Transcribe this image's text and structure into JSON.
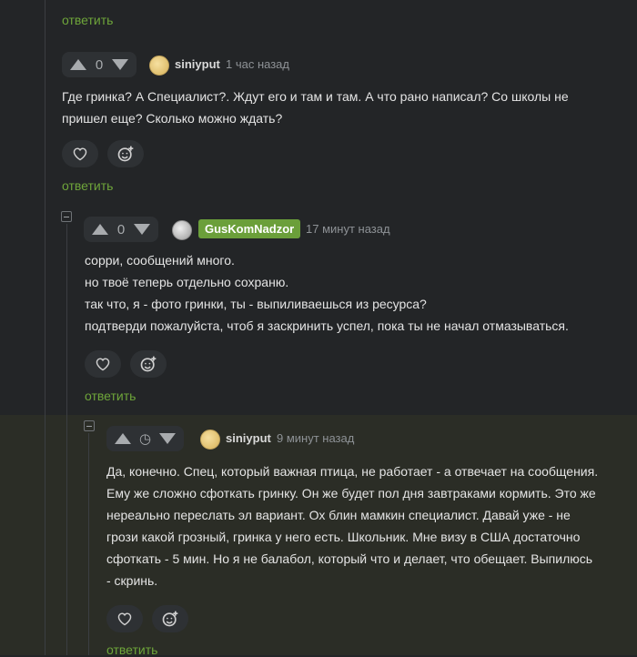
{
  "top": {
    "reply_label": "ответить"
  },
  "comments": [
    {
      "score": "0",
      "username": "siniyput",
      "time": "1 час назад",
      "lines": [
        "Где гринка? А Специалист?. Ждут его и там и там. А что рано написал? Со школы не",
        "пришел еще? Сколько можно ждать?"
      ],
      "reply_label": "ответить"
    },
    {
      "score": "0",
      "username": "GusKomNadzor",
      "time": "17 минут назад",
      "lines": [
        "сорри, сообщений много.",
        "но твоё теперь отдельно сохраню.",
        "так что, я - фото гринки, ты - выпиливаешься из ресурса?",
        "подтверди пожалуйста, чтоб я заскринить успел, пока ты не начал отмазываться."
      ],
      "reply_label": "ответить"
    },
    {
      "score": "",
      "username": "siniyput",
      "time": "9 минут назад",
      "lines": [
        "Да, конечно. Спец, который важная птица, не работает - а отвечает на сообщения.",
        "Ему же сложно сфоткать гринку. Он же будет пол дня завтраками кормить. Это же",
        "нереально переслать эл вариант. Ох блин мамкин специалист. Давай уже - не",
        "грози какой грозный, гринка у него есть. Школьник. Мне визу в США достаточно",
        "сфоткать - 5 мин. Но я не балабол, который что и делает, что обещает. Выпилюсь",
        "- скринь."
      ],
      "reply_label": "ответить"
    }
  ],
  "colors": {
    "background": "#232527",
    "accent": "#6ea53a",
    "highlight": "#2b2d26",
    "badge": "#6b9f3a"
  }
}
